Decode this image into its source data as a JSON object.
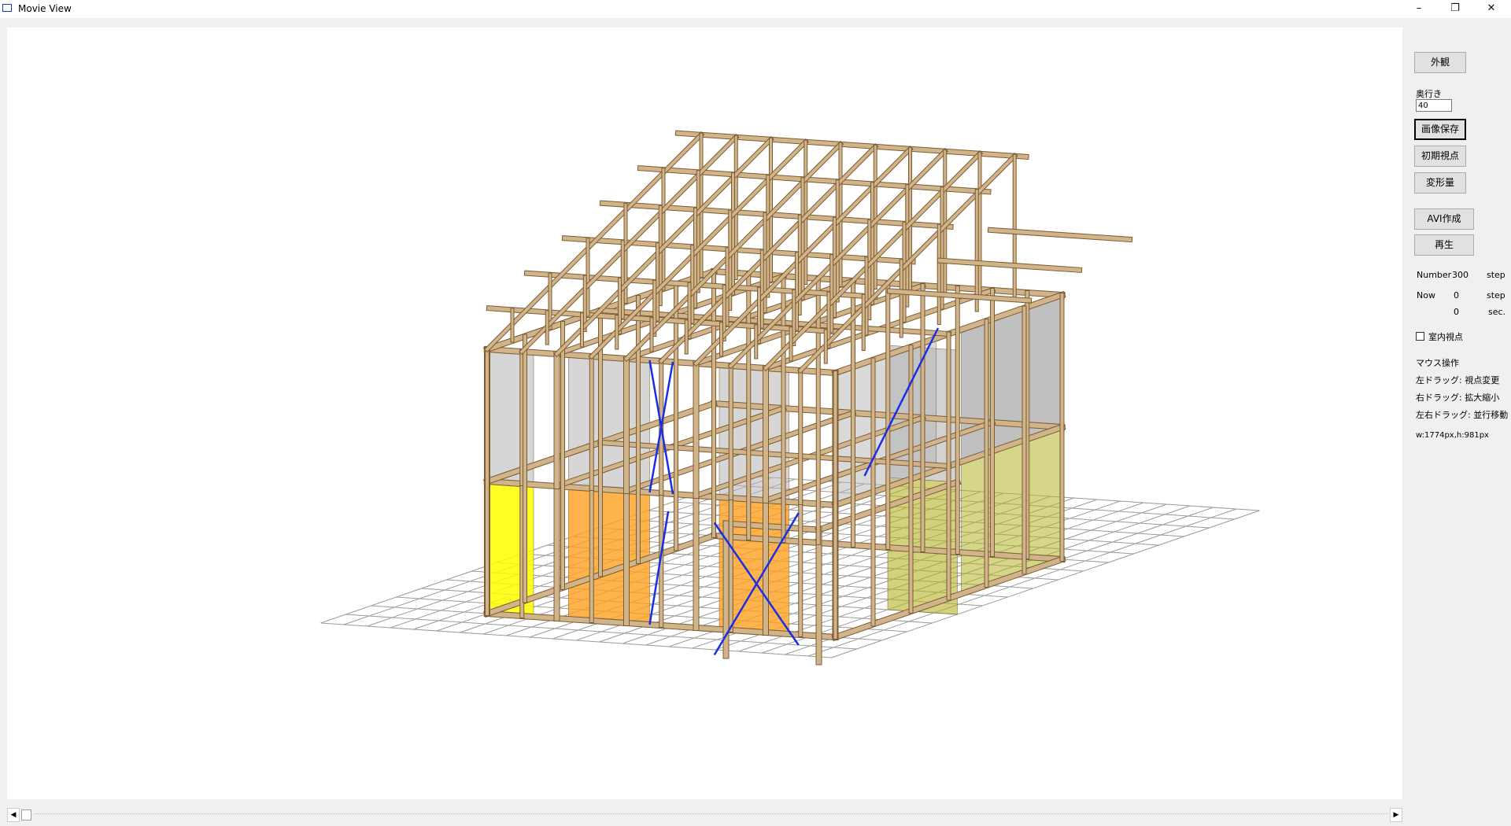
{
  "window": {
    "title": "Movie View",
    "minimize_glyph": "–",
    "restore_glyph": "❐",
    "close_glyph": "✕"
  },
  "panel": {
    "exterior_button": "外観",
    "depth_label": "奥行き",
    "depth_value": "40",
    "save_image_button": "画像保存",
    "initial_view_button": "初期視点",
    "deformation_button": "変形量",
    "avi_button": "AVI作成",
    "play_button": "再生",
    "number_label": "Number",
    "number_value": "300",
    "number_unit": "step",
    "now_label": "Now",
    "now_value": "0",
    "now_unit": "step",
    "sec_value": "0",
    "sec_unit": "sec.",
    "indoor_view_label": "室内視点",
    "indoor_view_checked": false,
    "mouse_title": "マウス操作",
    "mouse_left": "左ドラッグ: 視点変更",
    "mouse_right": "右ドラッグ: 拡大縮小",
    "mouse_both": "左右ドラッグ: 並行移動",
    "size_info": "w:1774px,h:981px"
  },
  "scrollbar": {
    "left_arrow": "◀",
    "right_arrow": "▶"
  },
  "colors": {
    "wood": "#d2b48a",
    "wood_edge": "#7a5c35",
    "yellow_wall": "#ffff00",
    "orange_wall": "#ffa020",
    "olive_wall": "#b4b428",
    "glass": "#b4b4b4",
    "brace": "#1a2ee6"
  }
}
